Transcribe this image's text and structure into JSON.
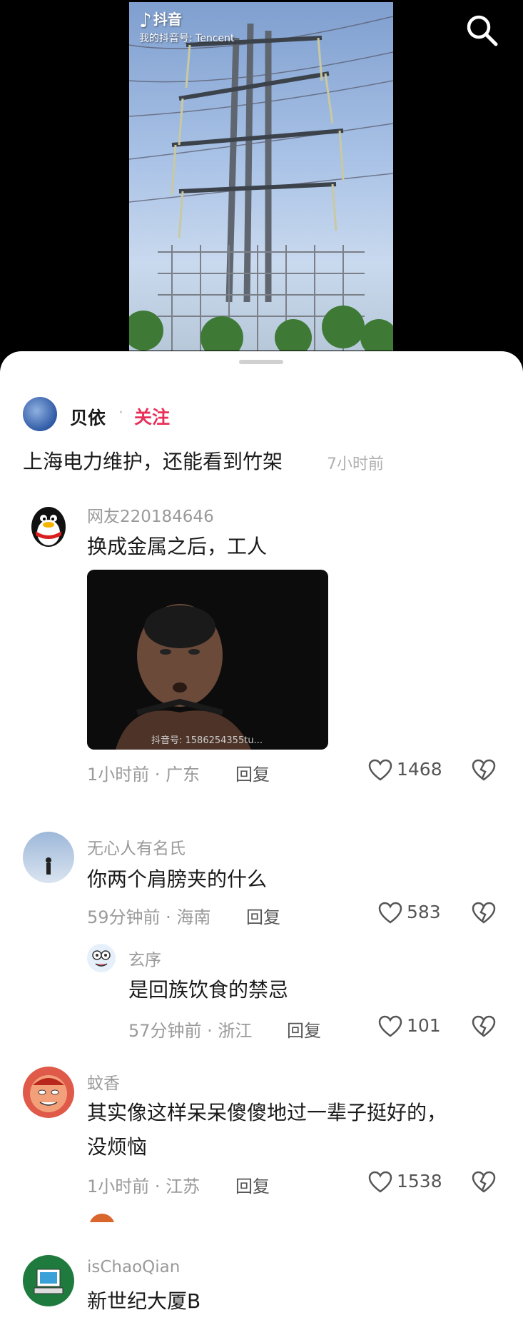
{
  "video": {
    "watermark_brand": "抖音",
    "watermark_sub": "我的抖音号: Tencent"
  },
  "post": {
    "author": "贝依",
    "separator": "·",
    "follow_label": "关注",
    "caption": "上海电力维护，还能看到竹架",
    "time": "7小时前"
  },
  "comments": [
    {
      "user": "网友220184646",
      "text": "换成金属之后，工人",
      "image_watermark": "抖音号: 1586254355tu...",
      "meta": "1小时前 · 广东",
      "reply_label": "回复",
      "likes": "1468"
    },
    {
      "user": "无心人有名氏",
      "text": "你两个肩膀夹的什么",
      "meta": "59分钟前 · 海南",
      "reply_label": "回复",
      "likes": "583",
      "replies": [
        {
          "user": "玄序",
          "text": "是回族饮食的禁忌",
          "meta": "57分钟前 · 浙江",
          "reply_label": "回复",
          "likes": "101"
        }
      ]
    },
    {
      "user": "蚊香",
      "text_line1": "其实像这样呆呆傻傻地过一辈子挺好的，",
      "text_line2": "没烦恼",
      "meta": "1小时前 · 江苏",
      "reply_label": "回复",
      "likes": "1538"
    },
    {
      "user": "isChaoQian",
      "text": "新世纪大厦B"
    }
  ],
  "colors": {
    "accent": "#e8315a",
    "muted": "#9a9a9a",
    "text": "#1a1a1a"
  },
  "icons": [
    "search-icon",
    "heart-icon",
    "broken-heart-icon"
  ]
}
